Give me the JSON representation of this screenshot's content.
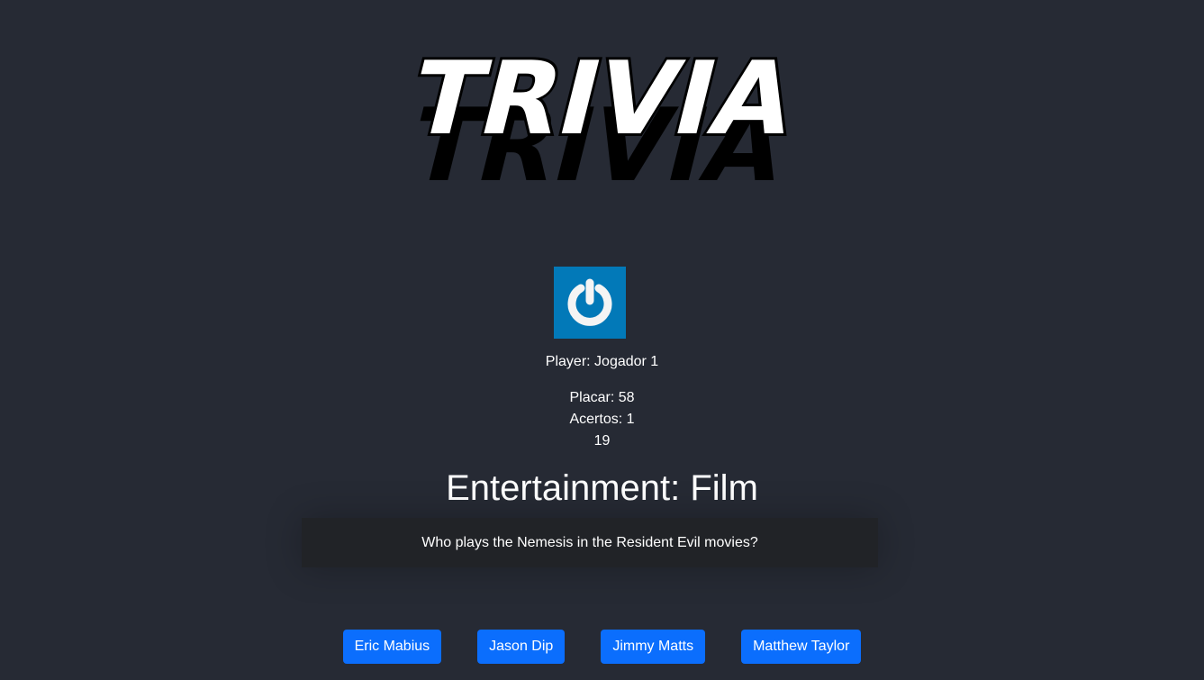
{
  "logo": {
    "text": "TRIVIA"
  },
  "player": {
    "label": "Player: Jogador 1",
    "avatar_icon": "power-icon"
  },
  "stats": {
    "score": "Placar: 58",
    "correct": "Acertos: 1",
    "timer": "19"
  },
  "question": {
    "category": "Entertainment: Film",
    "text": "Who plays the Nemesis in the Resident Evil movies?"
  },
  "answers": [
    "Eric Mabius",
    "Jason Dip",
    "Jimmy Matts",
    "Matthew Taylor"
  ],
  "colors": {
    "background": "#262a34",
    "button": "#0b6efd",
    "avatar_bg": "#0279b8"
  }
}
